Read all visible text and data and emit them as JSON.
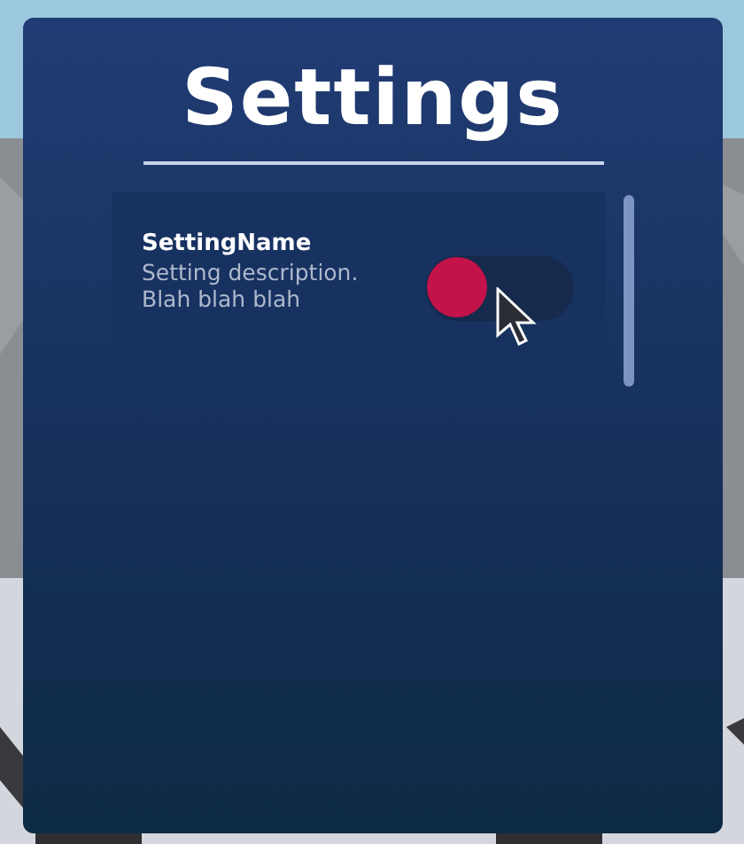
{
  "title": "Settings",
  "settings": [
    {
      "name": "SettingName",
      "description": "Setting description. Blah blah blah",
      "kind": "toggle",
      "on": false
    }
  ]
}
